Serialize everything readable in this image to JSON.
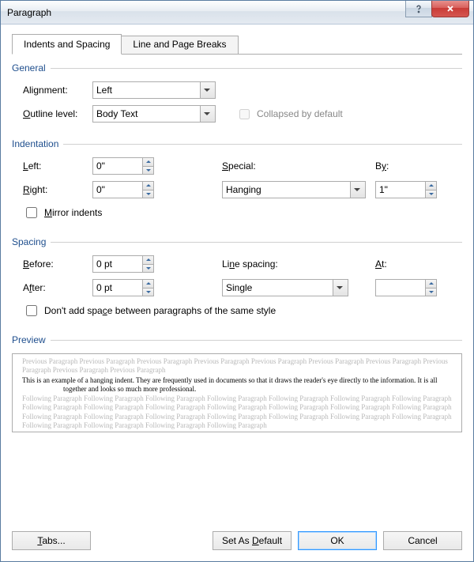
{
  "window": {
    "title": "Paragraph"
  },
  "tabs": {
    "indents": "Indents and Spacing",
    "lineBreaks": "Line and Page Breaks"
  },
  "general": {
    "header": "General",
    "alignment_label": "Alignment:",
    "alignment_value": "Left",
    "outline_label": "Outline level:",
    "outline_value": "Body Text",
    "collapsed_label": "Collapsed by default"
  },
  "indentation": {
    "header": "Indentation",
    "left_label": "Left:",
    "left_value": "0\"",
    "right_label": "Right:",
    "right_value": "0\"",
    "special_label": "Special:",
    "special_value": "Hanging",
    "by_label": "By:",
    "by_value": "1\"",
    "mirror_label": "Mirror indents"
  },
  "spacing": {
    "header": "Spacing",
    "before_label": "Before:",
    "before_value": "0 pt",
    "after_label": "After:",
    "after_value": "0 pt",
    "line_label": "Line spacing:",
    "line_value": "Single",
    "at_label": "At:",
    "at_value": "",
    "noadd_label": "Don't add space between paragraphs of the same style"
  },
  "preview": {
    "header": "Preview",
    "prev_text": "Previous Paragraph Previous Paragraph Previous Paragraph Previous Paragraph Previous Paragraph Previous Paragraph Previous Paragraph Previous Paragraph Previous Paragraph Previous Paragraph",
    "body_text": "This is an example of a hanging indent.  They are frequently used in documents so that it draws the reader's eye directly to the information.  It is all together and looks so much more professional.",
    "foll_text": "Following Paragraph Following Paragraph Following Paragraph Following Paragraph Following Paragraph Following Paragraph Following Paragraph Following Paragraph Following Paragraph Following Paragraph Following Paragraph Following Paragraph Following Paragraph Following Paragraph Following Paragraph Following Paragraph Following Paragraph Following Paragraph Following Paragraph Following Paragraph Following Paragraph Following Paragraph Following Paragraph Following Paragraph Following Paragraph"
  },
  "buttons": {
    "tabs": "Tabs...",
    "default": "Set As Default",
    "ok": "OK",
    "cancel": "Cancel"
  }
}
